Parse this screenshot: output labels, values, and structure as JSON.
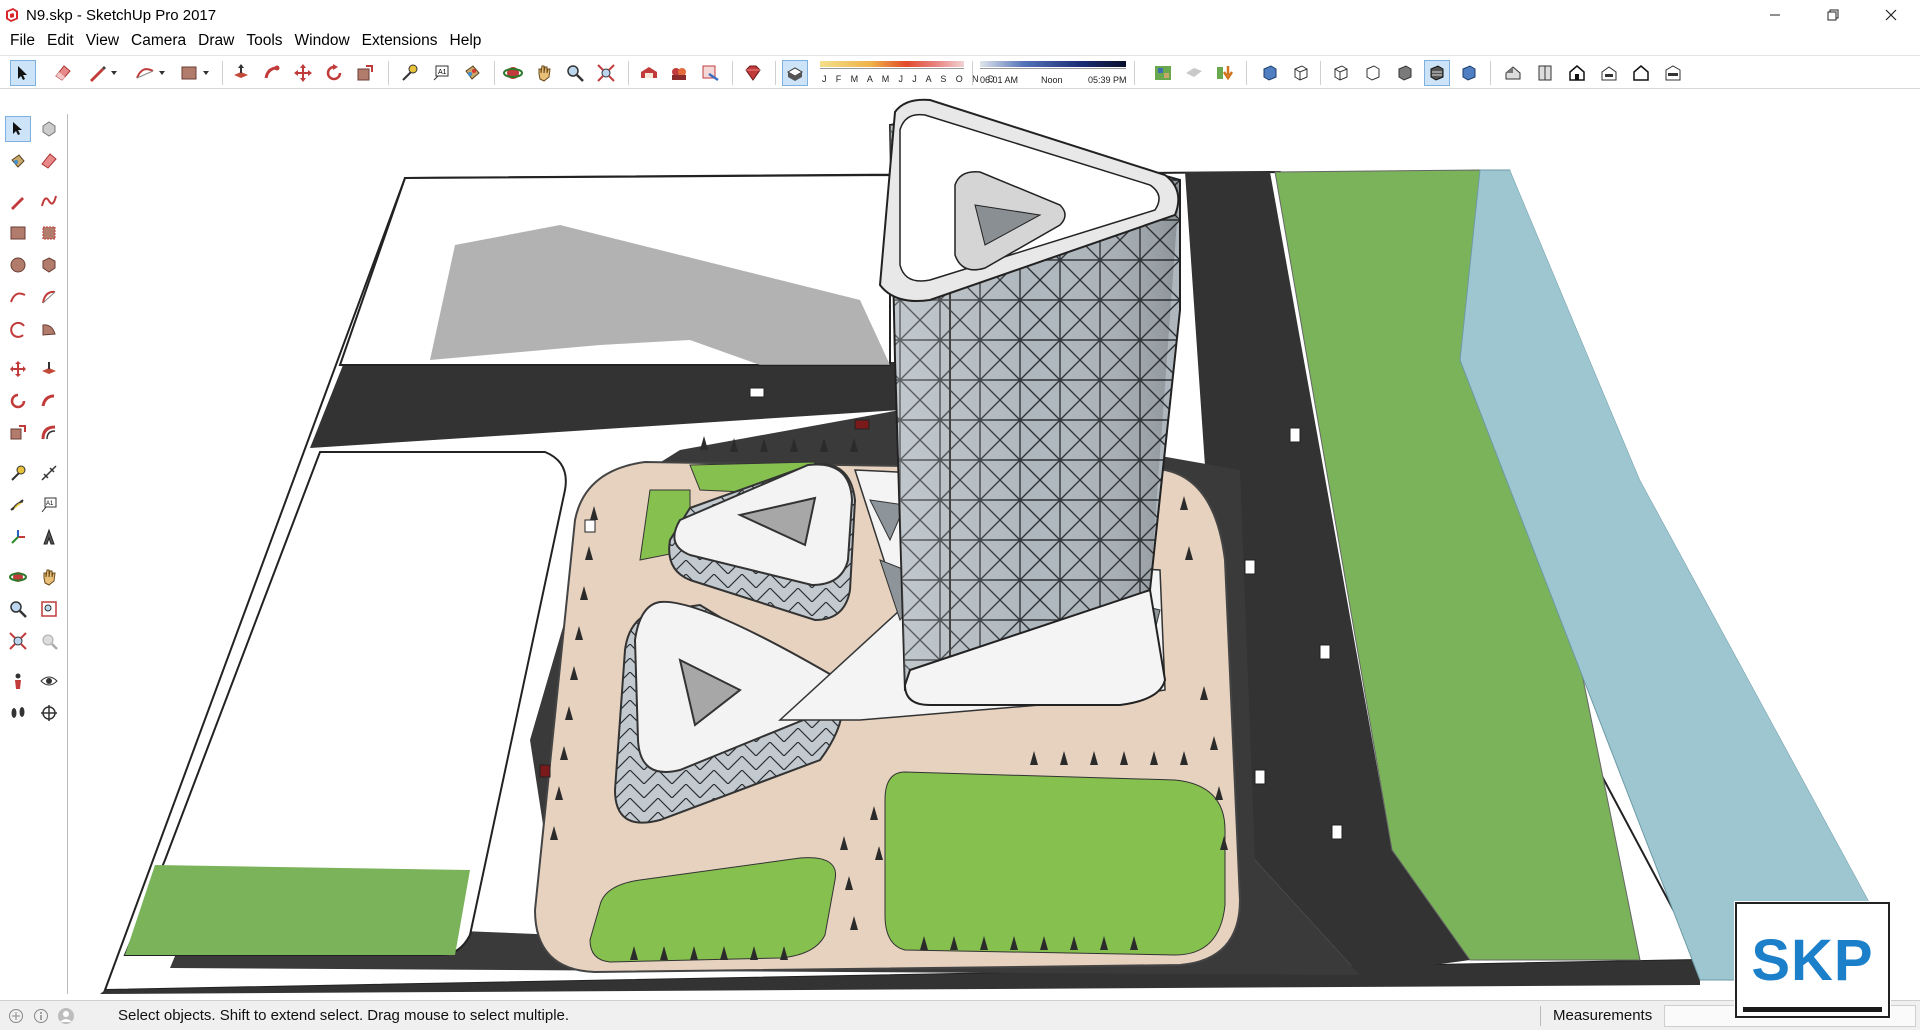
{
  "window": {
    "title": "N9.skp - SketchUp Pro 2017",
    "minimize_glyph": "─",
    "restore_glyph": "❐",
    "close_glyph": "✕"
  },
  "menu": [
    "File",
    "Edit",
    "View",
    "Camera",
    "Draw",
    "Tools",
    "Window",
    "Extensions",
    "Help"
  ],
  "toolbar": {
    "shadow_months": "J F M A M J J A S O N D",
    "time_start": "06:01 AM",
    "time_mid": "Noon",
    "time_end": "05:39 PM"
  },
  "status": {
    "message": "Select objects. Shift to extend select. Drag mouse to select multiple.",
    "measurements_label": "Measurements",
    "measurements_value": ""
  },
  "badge": {
    "text": "SKP"
  },
  "colors": {
    "grass": "#7ab35a",
    "water": "#9dc6d1",
    "road": "#2f2f2f",
    "plaza": "#e6d2bf",
    "accent": "#1c7fc9"
  }
}
